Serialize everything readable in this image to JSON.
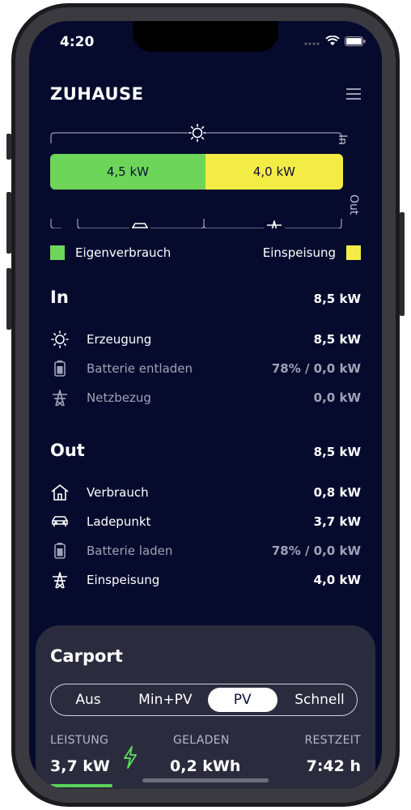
{
  "status": {
    "time": "4:20"
  },
  "header": {
    "title": "ZUHAUSE"
  },
  "flow": {
    "bar_left": "4,5 kW",
    "bar_right": "4,0 kW",
    "in_label": "In",
    "out_label": "Out",
    "left_fraction": 0.53,
    "colors": {
      "left": "#6dd65a",
      "right": "#f4ec46"
    }
  },
  "legend": {
    "left": "Eigenverbrauch",
    "right": "Einspeisung"
  },
  "in_section": {
    "title": "In",
    "total": "8,5 kW",
    "rows": [
      {
        "icon": "sun-icon",
        "label": "Erzeugung",
        "value": "8,5 kW"
      },
      {
        "icon": "battery-icon",
        "label": "Batterie entladen",
        "value": "78% / 0,0 kW"
      },
      {
        "icon": "power-tower-icon",
        "label": "Netzbezug",
        "value": "0,0 kW"
      }
    ]
  },
  "out_section": {
    "title": "Out",
    "total": "8,5 kW",
    "rows": [
      {
        "icon": "house-icon",
        "label": "Verbrauch",
        "value": "0,8 kW"
      },
      {
        "icon": "car-icon",
        "label": "Ladepunkt",
        "value": "3,7 kW"
      },
      {
        "icon": "battery-icon",
        "label": "Batterie laden",
        "value": "78% / 0,0 kW"
      },
      {
        "icon": "power-tower-icon",
        "label": "Einspeisung",
        "value": "4,0 kW"
      }
    ]
  },
  "carport": {
    "title": "Carport",
    "modes": [
      "Aus",
      "Min+PV",
      "PV",
      "Schnell"
    ],
    "selected_mode": "PV",
    "stats": {
      "leistung_label": "LEISTUNG",
      "leistung_value": "3,7 kW",
      "geladen_label": "GELADEN",
      "geladen_value": "0,2 kWh",
      "restzeit_label": "RESTZEIT",
      "restzeit_value": "7:42 h"
    }
  }
}
